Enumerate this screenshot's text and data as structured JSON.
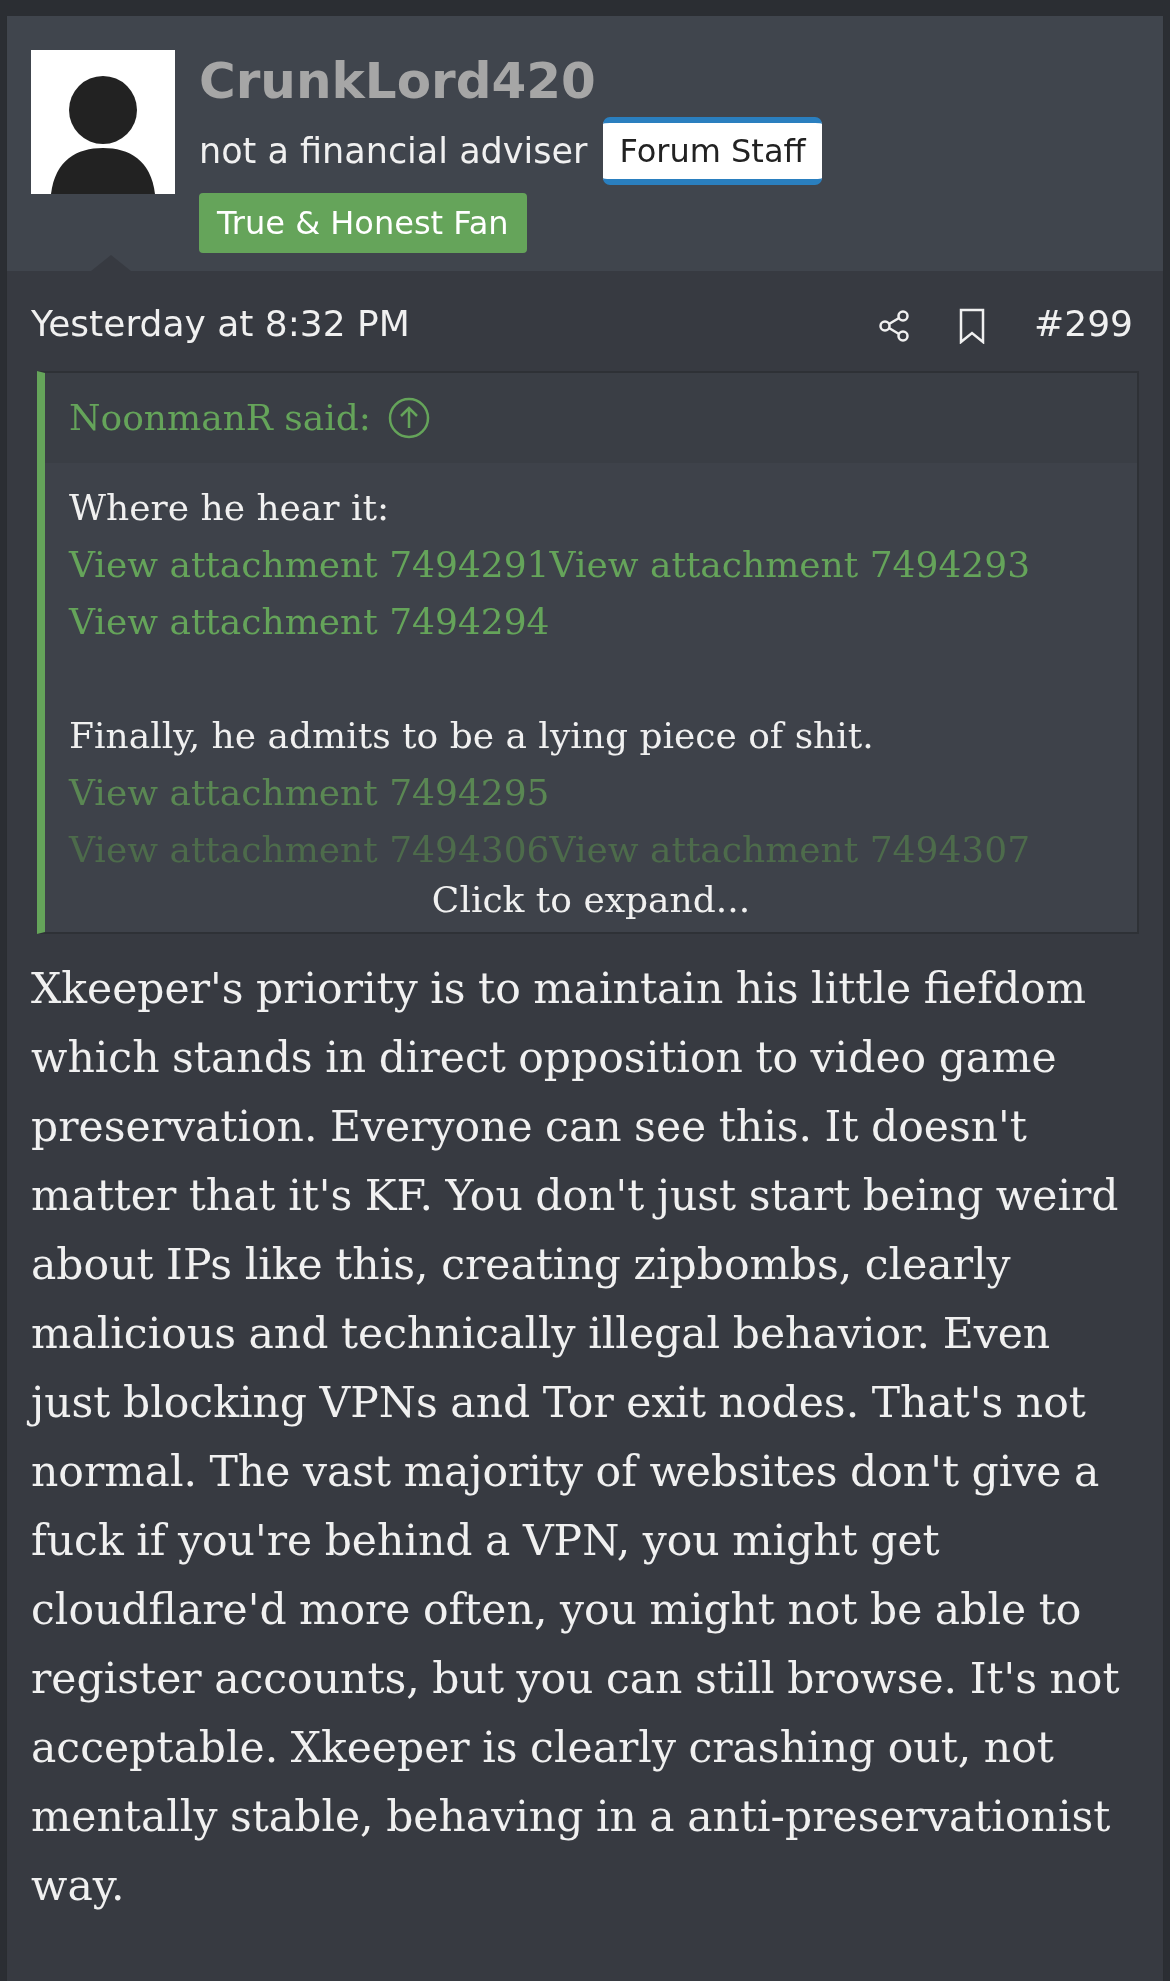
{
  "post": {
    "author": {
      "username": "CrunkLord420",
      "custom_title": "not a financial adviser",
      "banners": [
        {
          "kind": "staff",
          "label": "Forum Staff"
        },
        {
          "kind": "fan",
          "label": "True & Honest Fan"
        }
      ]
    },
    "date": "Yesterday at 8:32 PM",
    "post_number": "#299",
    "quote": {
      "attribution": "NoonmanR said:",
      "collapsed": true,
      "expand_label": "Click to expand...",
      "paragraphs": [
        [
          [
            {
              "kind": "text",
              "text": "Where he hear it:"
            }
          ],
          [
            {
              "kind": "link",
              "text": "View attachment 7494291"
            },
            {
              "kind": "link",
              "text": "View attachment 7494293"
            },
            {
              "kind": "link",
              "text": "View attachment 7494294"
            }
          ]
        ],
        [
          [
            {
              "kind": "text",
              "text": "Finally, he admits to be a lying piece of shit."
            }
          ],
          [
            {
              "kind": "link",
              "text": "View attachment 7494295"
            }
          ],
          [
            {
              "kind": "link",
              "text": "View attachment 7494306"
            },
            {
              "kind": "link",
              "text": "View attachment 7494307"
            }
          ]
        ]
      ]
    },
    "body": "Xkeeper's priority is to maintain his little fiefdom which stands in direct opposition to video game preservation. Everyone can see this. It doesn't matter that it's KF. You don't just start being weird about IPs like this, creating zipbombs, clearly malicious and technically illegal behavior. Even just blocking VPNs and Tor exit nodes. That's not normal. The vast majority of websites don't give a fuck if you're behind a VPN, you might get cloudflare'd more often, you might not be able to register accounts, but you can still browse. It's not acceptable. Xkeeper is clearly crashing out, not mentally stable, behaving in a anti-preservationist way."
  }
}
